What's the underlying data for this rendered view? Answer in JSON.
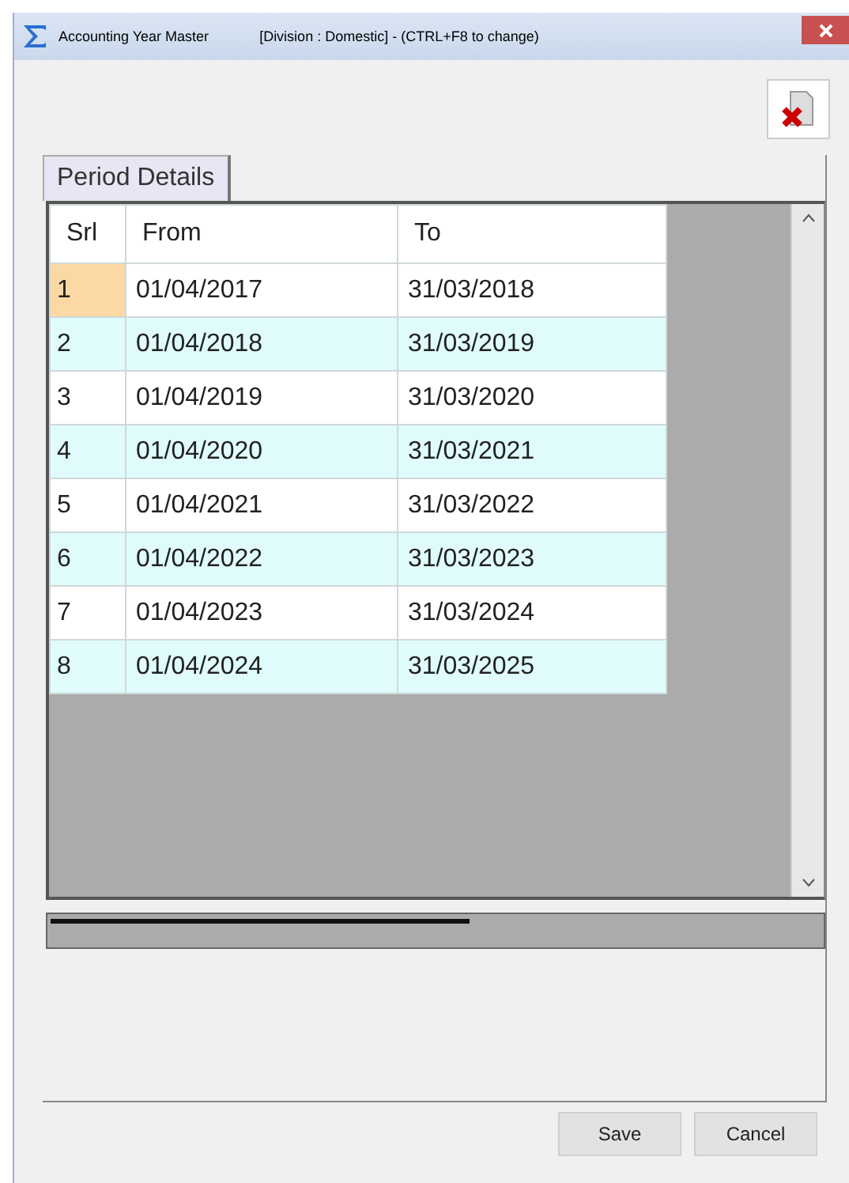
{
  "window": {
    "title": "Accounting Year Master",
    "division_note": "[Division : Domestic] - (CTRL+F8 to change)"
  },
  "tabs": [
    {
      "label": "Period Details",
      "selected": true
    }
  ],
  "table": {
    "columns": [
      "Srl",
      "From",
      "To"
    ],
    "rows": [
      {
        "cells": [
          "1",
          "01/04/2017",
          "31/03/2018"
        ],
        "selected": true
      },
      {
        "cells": [
          "2",
          "01/04/2018",
          "31/03/2019"
        ],
        "selected": false
      },
      {
        "cells": [
          "3",
          "01/04/2019",
          "31/03/2020"
        ],
        "selected": false
      },
      {
        "cells": [
          "4",
          "01/04/2020",
          "31/03/2021"
        ],
        "selected": false
      },
      {
        "cells": [
          "5",
          "01/04/2021",
          "31/03/2022"
        ],
        "selected": false
      },
      {
        "cells": [
          "6",
          "01/04/2022",
          "31/03/2023"
        ],
        "selected": false
      },
      {
        "cells": [
          "7",
          "01/04/2023",
          "31/03/2024"
        ],
        "selected": false
      },
      {
        "cells": [
          "8",
          "01/04/2024",
          "31/03/2025"
        ],
        "selected": false
      }
    ]
  },
  "buttons": [
    "Save",
    "Cancel"
  ]
}
